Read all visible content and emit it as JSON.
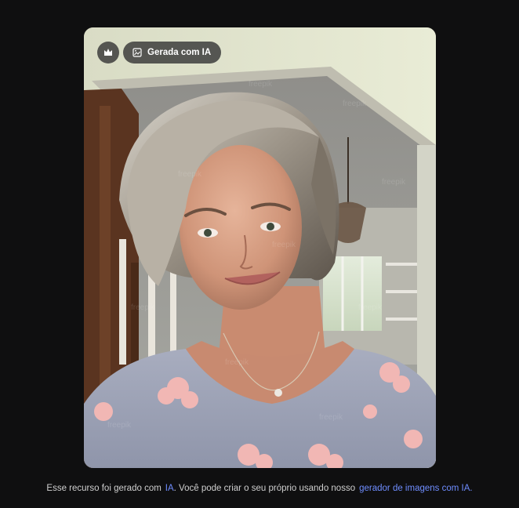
{
  "image": {
    "alt": "Selfie de mulher madura de cabelos grisalhos sorrindo em casa",
    "watermark": "freepik"
  },
  "badges": {
    "premium_icon": "crown-icon",
    "ai_icon": "ai-image-icon",
    "ai_label": "Gerada com IA"
  },
  "footer": {
    "text_before": "Esse recurso foi gerado com",
    "link_ia": "IA",
    "text_middle": ". Você pode criar o seu próprio usando nosso",
    "link_generator": "gerador de imagens com IA."
  },
  "colors": {
    "background": "#0f0f10",
    "link": "#6f8dff",
    "badge_bg": "#373737"
  }
}
